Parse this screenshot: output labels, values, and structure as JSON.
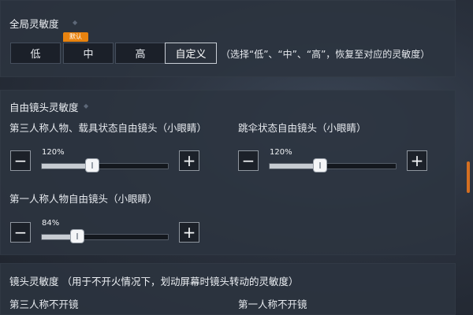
{
  "global_section": {
    "title": "全局灵敏度",
    "options": [
      "低",
      "中",
      "高",
      "自定义"
    ],
    "selected": "自定义",
    "badge": "默认",
    "hint": "（选择“低”、“中”、“高”，恢复至对应的灵敏度）"
  },
  "free_cam_section": {
    "title": "自由镜头灵敏度",
    "sliders": [
      {
        "label": "第三人称人物、载具状态自由镜头（小眼睛）",
        "value_text": "120%",
        "fraction": 0.4
      },
      {
        "label": "跳伞状态自由镜头（小眼睛）",
        "value_text": "120%",
        "fraction": 0.4
      },
      {
        "label": "第一人称人物自由镜头（小眼睛）",
        "value_text": "84%",
        "fraction": 0.28
      }
    ],
    "minus_symbol": "−",
    "plus_symbol": "+"
  },
  "camera_section": {
    "title": "镜头灵敏度 （用于不开火情况下，划动屏幕时镜头转动的灵敏度）",
    "items": [
      "第三人称不开镜",
      "第一人称不开镜"
    ]
  },
  "colors": {
    "accent": "#e8830f",
    "scrollbar": "#d56f21"
  }
}
